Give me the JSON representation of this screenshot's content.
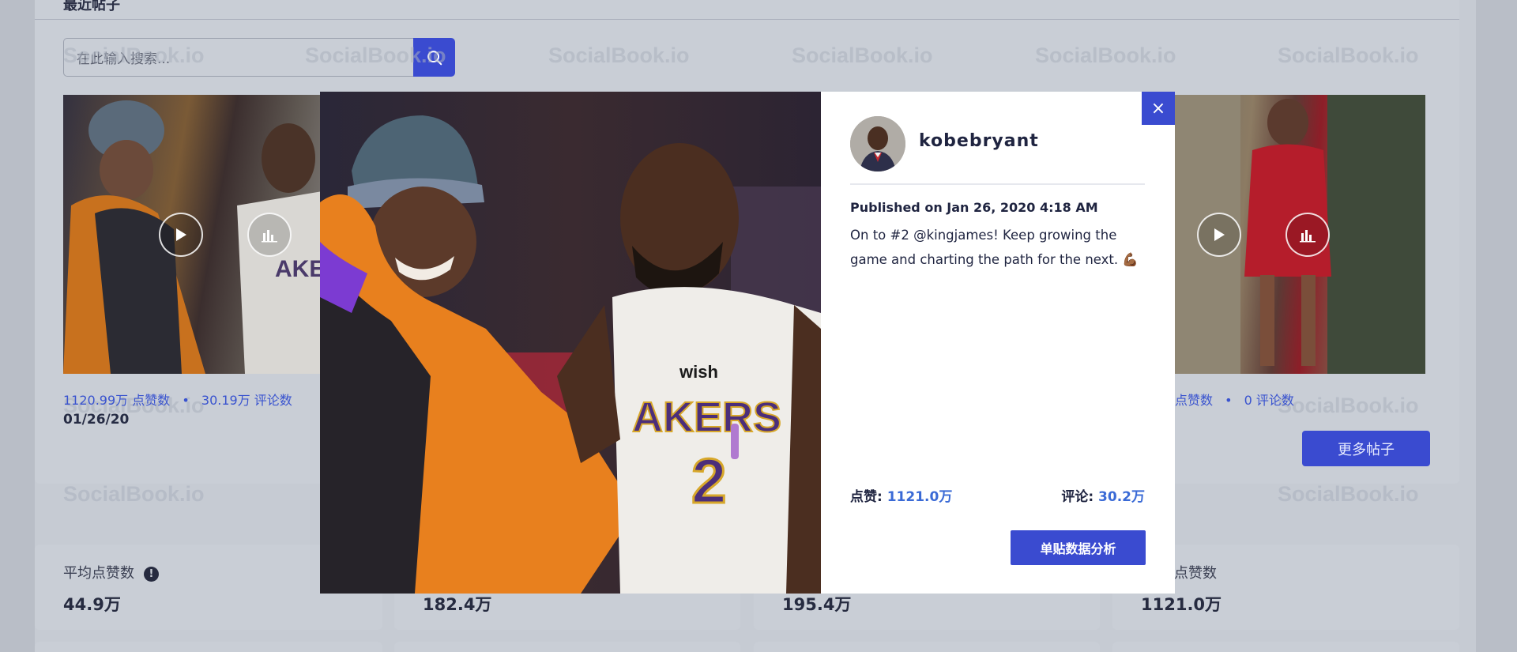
{
  "section": {
    "title": "最近帖子"
  },
  "search": {
    "placeholder": "在此输入搜索..."
  },
  "watermark": "SocialBook.io",
  "posts": [
    {
      "likes": "1120.99万 点赞数",
      "separator": "•",
      "comments": "30.19万 评论数",
      "date": "01/26/20"
    },
    {
      "likes_tail": "点赞数",
      "separator": "•",
      "comments": "0 评论数"
    }
  ],
  "more_button": "更多帖子",
  "metrics": [
    {
      "label": "平均点赞数",
      "info": "!",
      "value": "44.9万"
    },
    {
      "label": "",
      "value": "182.4万"
    },
    {
      "label": "",
      "value": "195.4万"
    },
    {
      "label": "点赞数",
      "value": "1121.0万"
    }
  ],
  "modal": {
    "close": "×",
    "username": "kobebryant",
    "published": "Published on Jan 26, 2020 4:18 AM",
    "caption": "On to #2 @kingjames! Keep growing the game and charting the path for the next. 💪🏾",
    "likes_label": "点赞: ",
    "likes_value": "1121.0万",
    "comments_label": "评论: ",
    "comments_value": "30.2万",
    "analysis_button": "单贴数据分析",
    "jersey_text": "AKERS",
    "jersey_brand": "wish"
  },
  "colors": {
    "accent": "#3a4bd0",
    "link": "#3a6ad6",
    "overlay": "#c6cbd3"
  }
}
